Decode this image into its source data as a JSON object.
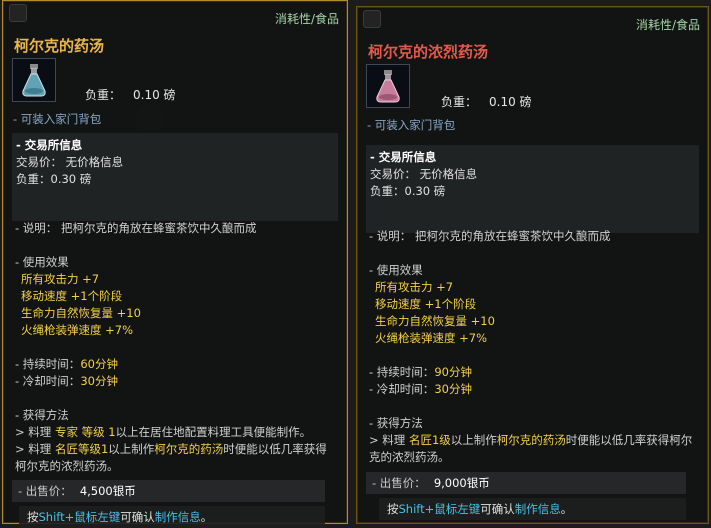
{
  "left": {
    "category": "消耗性/食品",
    "title": "柯尔克的药汤",
    "weight_label": "负重：",
    "weight_value": "0.10 磅",
    "storable": "- 可装入家门背包",
    "exchange_head": "- 交易所信息",
    "exchange_price": "交易价： 无价格信息",
    "exchange_weight": "负重：0.30 磅",
    "desc": "- 说明： 把柯尔克的角放在蜂蜜茶饮中久酿而成",
    "effect_head": "- 使用效果",
    "effects": [
      "所有攻击力 +7",
      "移动速度 +1个阶段",
      "生命力自然恢复量 +10",
      "火绳枪装弹速度 +7%"
    ],
    "duration_label": "- 持续时间：",
    "duration_value": "60分钟",
    "cooldown_label": "- 冷却时间：",
    "cooldown_value": "30分钟",
    "obtain_head": "- 获得方法",
    "obtain_1a": " > 料理 ",
    "obtain_1b": "专家 等级 1",
    "obtain_1c": "以上在居住地配置料理工具便能制作。",
    "obtain_2a": " > 料理 ",
    "obtain_2b": "名匠等级1",
    "obtain_2c": "以上制作",
    "obtain_2d": "柯尔克的药汤",
    "obtain_2e": "时便能以低几率获得柯尔克的浓烈药汤。",
    "sale_label": "- 出售价：",
    "sale_value": "4,500银币",
    "hint_a": "按",
    "hint_b": "Shift+鼠标左键",
    "hint_c": "可确认",
    "hint_d": "制作信息",
    "hint_e": "。",
    "potion_color": "#5fa3b5"
  },
  "right": {
    "category": "消耗性/食品",
    "title": "柯尔克的浓烈药汤",
    "weight_label": "负重：",
    "weight_value": "0.10 磅",
    "storable": "- 可装入家门背包",
    "exchange_head": "- 交易所信息",
    "exchange_price": "交易价： 无价格信息",
    "exchange_weight": "负重：0.30 磅",
    "desc": "- 说明： 把柯尔克的角放在蜂蜜茶饮中久酿而成",
    "effect_head": "- 使用效果",
    "effects": [
      "所有攻击力 +7",
      "移动速度 +1个阶段",
      "生命力自然恢复量 +10",
      "火绳枪装弹速度 +7%"
    ],
    "duration_label": "- 持续时间：",
    "duration_value": "90分钟",
    "cooldown_label": "- 冷却时间：",
    "cooldown_value": "30分钟",
    "obtain_head": "- 获得方法",
    "obtain_2a": " > 料理 ",
    "obtain_2b": "名匠1级",
    "obtain_2c": "以上制作",
    "obtain_2d": "柯尔克的药汤",
    "obtain_2e": "时便能以低几率获得柯尔克的浓烈药汤。",
    "sale_label": "- 出售价：",
    "sale_value": "9,000银币",
    "hint_a": "按",
    "hint_b": "Shift+鼠标左键",
    "hint_c": "可确认",
    "hint_d": "制作信息",
    "hint_e": "。",
    "potion_color": "#c77d9a"
  }
}
